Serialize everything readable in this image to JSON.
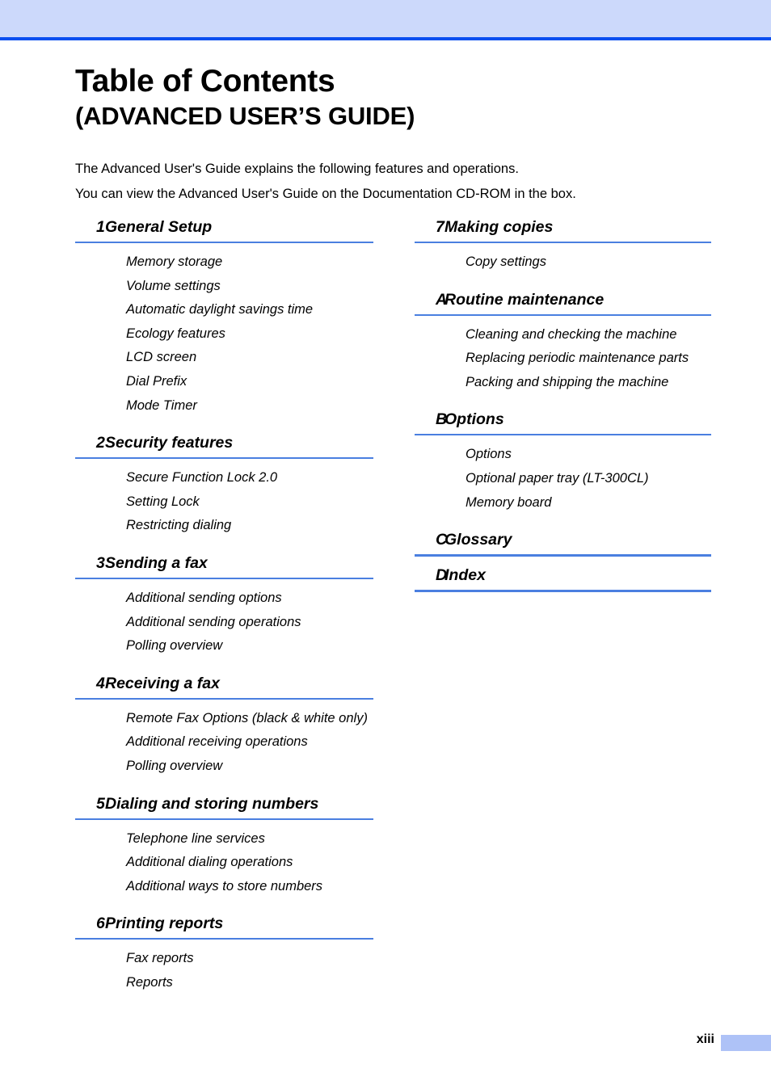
{
  "header": {
    "band_color": "#ccd9fb",
    "rule_color": "#0a4ff0"
  },
  "title": {
    "main": "Table of Contents",
    "sub": "(ADVANCED USER’S GUIDE)"
  },
  "intro": {
    "line1": "The Advanced User's Guide explains the following features and operations.",
    "line2": "You can view the Advanced User's Guide on the Documentation CD-ROM in the box."
  },
  "accent": {
    "rule_color": "#4a7fe0",
    "footer_block_color": "#aec2f7"
  },
  "columns": {
    "left": [
      {
        "num": "1",
        "title": "General Setup",
        "entries": [
          "Memory storage",
          "Volume settings",
          "Automatic daylight savings time",
          "Ecology features",
          "LCD screen",
          "Dial Prefix",
          "Mode Timer"
        ]
      },
      {
        "num": "2",
        "title": "Security features",
        "entries": [
          "Secure Function Lock 2.0",
          "Setting Lock",
          "Restricting dialing"
        ]
      },
      {
        "num": "3",
        "title": "Sending a fax",
        "entries": [
          "Additional sending options",
          "Additional sending operations",
          "Polling overview"
        ]
      },
      {
        "num": "4",
        "title": "Receiving a fax",
        "entries": [
          "Remote Fax Options (black & white only)",
          "Additional receiving operations",
          "Polling overview"
        ]
      },
      {
        "num": "5",
        "title": "Dialing and storing numbers",
        "entries": [
          "Telephone line services",
          "Additional dialing operations",
          "Additional ways to store numbers"
        ]
      },
      {
        "num": "6",
        "title": "Printing reports",
        "entries": [
          "Fax reports",
          "Reports"
        ]
      }
    ],
    "right": [
      {
        "num": "7",
        "title": "Making copies",
        "entries": [
          "Copy settings"
        ]
      },
      {
        "num": "A",
        "title": "Routine maintenance",
        "entries": [
          "Cleaning and checking the machine",
          "Replacing periodic maintenance parts",
          "Packing and shipping the machine"
        ]
      },
      {
        "num": "B",
        "title": "Options",
        "entries": [
          "Options",
          "Optional paper tray (LT-300CL)",
          "Memory board"
        ]
      },
      {
        "num": "C",
        "title": "Glossary",
        "entries": []
      },
      {
        "num": "D",
        "title": "Index",
        "entries": []
      }
    ]
  },
  "footer": {
    "page_number": "xiii"
  }
}
